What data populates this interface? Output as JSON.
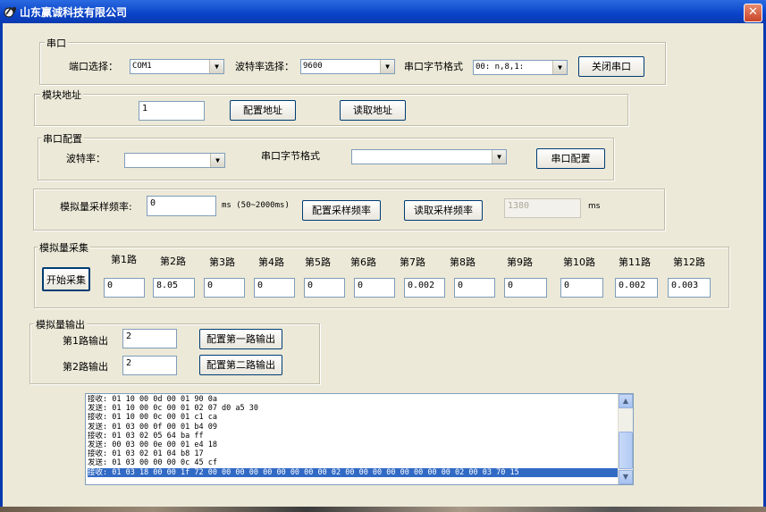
{
  "window": {
    "title": "山东赢诚科技有限公司",
    "close_glyph": "✕"
  },
  "serial": {
    "group_label": "串口",
    "port_label": "端口选择：",
    "port_value": "COM1",
    "baud_label": "波特率选择：",
    "baud_value": "9600",
    "format_label": "串口字节格式",
    "format_value": "00: n,8,1:",
    "close_button": "关闭串口"
  },
  "module_address": {
    "group_label": "模块地址",
    "value": "1",
    "config_button": "配置地址",
    "read_button": "读取地址"
  },
  "serial_config": {
    "group_label": "串口配置",
    "baud_label": "波特率：",
    "baud_value": "",
    "format_label": "串口字节格式",
    "format_value": "",
    "config_button": "串口配置"
  },
  "sampling": {
    "label": "模拟量采样频率:",
    "value": "0",
    "unit_range": "ms (50~2000ms)",
    "config_button": "配置采样频率",
    "read_button": "读取采样频率",
    "read_value": "1380",
    "read_unit": "ms"
  },
  "acquisition": {
    "group_label": "模拟量采集",
    "start_button": "开始采集",
    "channels": [
      {
        "label": "第1路",
        "value": "0"
      },
      {
        "label": "第2路",
        "value": "8.05"
      },
      {
        "label": "第3路",
        "value": "0"
      },
      {
        "label": "第4路",
        "value": "0"
      },
      {
        "label": "第5路",
        "value": "0"
      },
      {
        "label": "第6路",
        "value": "0"
      },
      {
        "label": "第7路",
        "value": "0.002"
      },
      {
        "label": "第8路",
        "value": "0"
      },
      {
        "label": "第9路",
        "value": "0"
      },
      {
        "label": "第10路",
        "value": "0"
      },
      {
        "label": "第11路",
        "value": "0.002"
      },
      {
        "label": "第12路",
        "value": "0.003"
      }
    ]
  },
  "output": {
    "group_label": "模拟量输出",
    "ch1_label": "第1路输出",
    "ch1_value": "2",
    "ch1_button": "配置第一路输出",
    "ch2_label": "第2路输出",
    "ch2_value": "2",
    "ch2_button": "配置第二路输出"
  },
  "log": {
    "lines": [
      "接收: 01 10 00 0d 00 01 90 0a",
      "发送: 01 10 00 0c 00 01 02 07 d0 a5 30",
      "接收: 01 10 00 0c 00 01 c1 ca",
      "发送: 01 03 00 0f 00 01 b4 09",
      "接收: 01 03 02 05 64 ba ff",
      "发送: 00 03 00 0e 00 01 e4 18",
      "接收: 01 03 02 01 04 b8 17",
      "发送: 01 03 00 00 00 0c 45 cf",
      "接收: 01 03 18 00 00 1f 72 00 00 00 00 00 00 00 00 00 02 00 00 00 00 00 00 00 00 02 00 03 70 15"
    ],
    "selected_index": 8
  }
}
